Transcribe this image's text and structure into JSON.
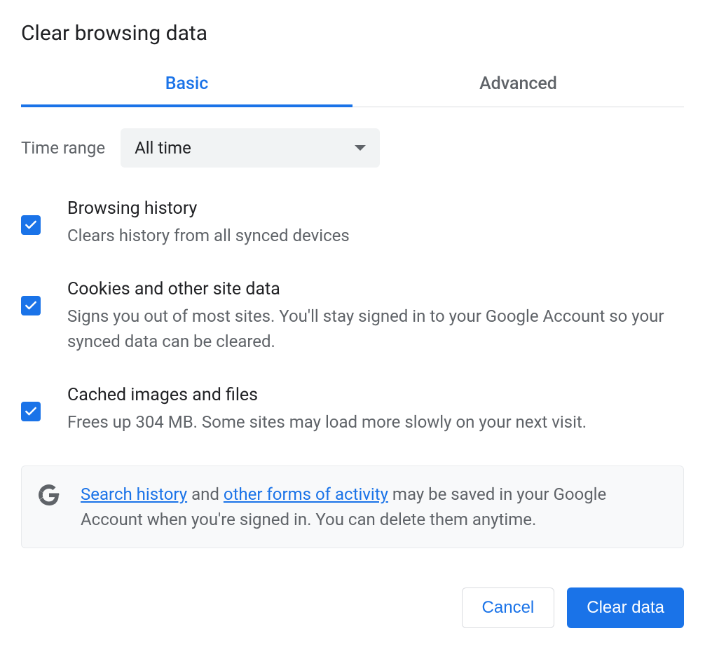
{
  "title": "Clear browsing data",
  "tabs": {
    "basic": "Basic",
    "advanced": "Advanced"
  },
  "timeRange": {
    "label": "Time range",
    "value": "All time"
  },
  "options": [
    {
      "title": "Browsing history",
      "desc": "Clears history from all synced devices",
      "checked": true
    },
    {
      "title": "Cookies and other site data",
      "desc": "Signs you out of most sites. You'll stay signed in to your Google Account so your synced data can be cleared.",
      "checked": true
    },
    {
      "title": "Cached images and files",
      "desc": "Frees up 304 MB. Some sites may load more slowly on your next visit.",
      "checked": true
    }
  ],
  "info": {
    "link1": "Search history",
    "mid1": " and ",
    "link2": "other forms of activity",
    "rest": " may be saved in your Google Account when you're signed in. You can delete them anytime."
  },
  "buttons": {
    "cancel": "Cancel",
    "clear": "Clear data"
  }
}
